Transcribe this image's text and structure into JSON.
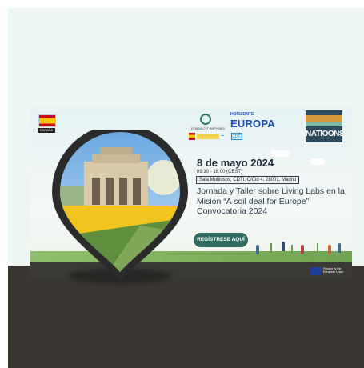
{
  "banner": {
    "flag_label": "ESPAÑA",
    "fondecyt_text": "FONDECYT·MIPYMES",
    "horizonte_small": "HORIZONTE",
    "horizonte_big": "EUROPA",
    "gov_label": "CDTI",
    "nations_logo": "NATIOONS",
    "date": "8 de mayo 2024",
    "time": "09:30 - 16:00 (CEST)",
    "venue": "Sala Multiusos, CDTI, C/Cid 4, 28001, Madrid",
    "title": "Jornada y Taller sobre Living Labs en la Misión “A soil deal for Europe” Convocatoria 2024",
    "cta_label": "REGÍSTRESE AQUÍ",
    "eu_funded": "Funded by the European Union"
  },
  "colors": {
    "page_bg": "#edf6f2",
    "ground": "#3a3631",
    "cta": "#2e6b60",
    "title": "#2a3b47",
    "brand_blue": "#1d4ea3"
  },
  "icons": [
    "spain-flag-icon",
    "eu-flag-icon",
    "map-pin-photo-icon"
  ]
}
